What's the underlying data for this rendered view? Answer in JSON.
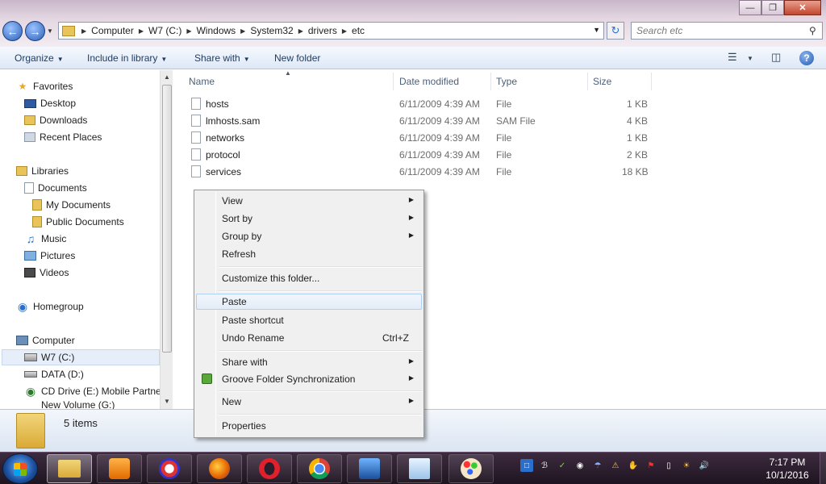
{
  "window": {
    "controls": {
      "minimize": "—",
      "maximize": "❐",
      "close": "✕"
    }
  },
  "address_bar": {
    "crumbs": [
      "Computer",
      "W7 (C:)",
      "Windows",
      "System32",
      "drivers",
      "etc"
    ]
  },
  "search": {
    "placeholder": "Search etc"
  },
  "toolbar": {
    "organize": "Organize",
    "include_in_library": "Include in library",
    "share_with": "Share with",
    "new_folder": "New folder"
  },
  "nav": {
    "favorites": "Favorites",
    "desktop": "Desktop",
    "downloads": "Downloads",
    "recent_places": "Recent Places",
    "libraries": "Libraries",
    "documents": "Documents",
    "my_documents": "My Documents",
    "public_documents": "Public Documents",
    "music": "Music",
    "pictures": "Pictures",
    "videos": "Videos",
    "homegroup": "Homegroup",
    "computer": "Computer",
    "w7": "W7 (C:)",
    "data": "DATA (D:)",
    "cd_drive": "CD Drive (E:) Mobile Partner",
    "new_volume": "New Volume (G:)"
  },
  "columns": {
    "name": "Name",
    "date_modified": "Date modified",
    "type": "Type",
    "size": "Size"
  },
  "files": [
    {
      "name": "hosts",
      "date": "6/11/2009 4:39 AM",
      "type": "File",
      "size": "1 KB"
    },
    {
      "name": "lmhosts.sam",
      "date": "6/11/2009 4:39 AM",
      "type": "SAM File",
      "size": "4 KB"
    },
    {
      "name": "networks",
      "date": "6/11/2009 4:39 AM",
      "type": "File",
      "size": "1 KB"
    },
    {
      "name": "protocol",
      "date": "6/11/2009 4:39 AM",
      "type": "File",
      "size": "2 KB"
    },
    {
      "name": "services",
      "date": "6/11/2009 4:39 AM",
      "type": "File",
      "size": "18 KB"
    }
  ],
  "context_menu": {
    "view": "View",
    "sort_by": "Sort by",
    "group_by": "Group by",
    "refresh": "Refresh",
    "customize": "Customize this folder...",
    "paste": "Paste",
    "paste_shortcut": "Paste shortcut",
    "undo_rename": "Undo Rename",
    "undo_shortcut": "Ctrl+Z",
    "share_with": "Share with",
    "groove": "Groove Folder Synchronization",
    "new": "New",
    "properties": "Properties"
  },
  "details": {
    "items_count": "5 items"
  },
  "clock": {
    "time": "7:17 PM",
    "date": "10/1/2016"
  },
  "colors": {
    "accent": "#2a5fb8",
    "selection": "#e6eef9",
    "taskbar": "#2a1d2c"
  }
}
